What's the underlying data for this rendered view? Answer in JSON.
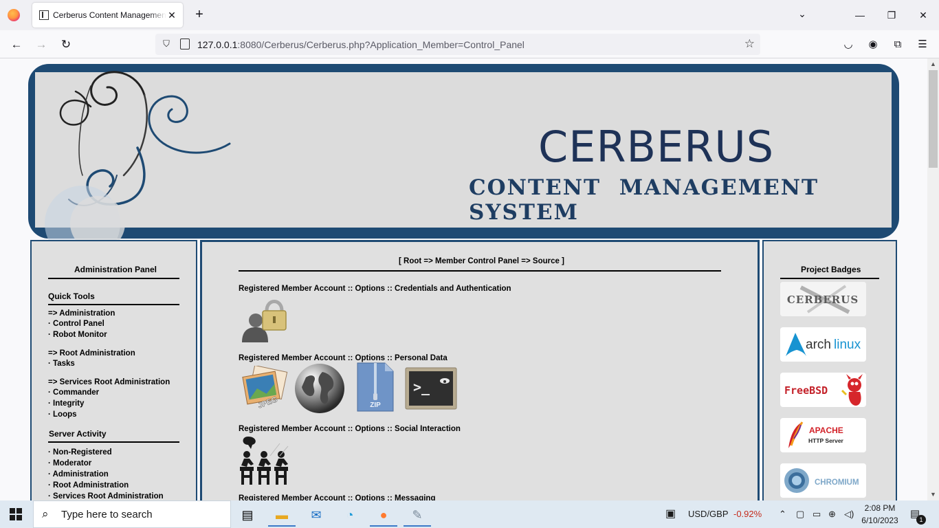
{
  "browser": {
    "tab_title": "Cerberus Content Management System",
    "new_tab": "+",
    "tab_close": "✕",
    "url_host": "127.0.0.1",
    "url_rest": ":8080/Cerberus/Cerberus.php?Application_Member=Control_Panel"
  },
  "banner": {
    "title": "CERBERUS",
    "subtitle": "CONTENT MANAGEMENT SYSTEM"
  },
  "left_panel": {
    "admin_title": "Administration Panel",
    "quick_tools_title": "Quick Tools",
    "items": [
      "=> Administration",
      "· Control Panel",
      "· Robot Monitor",
      "=> Root Administration",
      "· Tasks",
      "=> Services Root Administration",
      "· Commander",
      "· Integrity",
      "· Loops"
    ],
    "server_activity_title": "Server Activity",
    "activity_items": [
      "· Non-Registered",
      "· Moderator",
      "· Administration",
      "· Root Administration",
      "· Services Root Administration"
    ]
  },
  "center": {
    "breadcrumb": "[ Root => Member Control Panel => Source ]",
    "sections": [
      "Registered Member Account :: Options :: Credentials and Authentication",
      "Registered Member Account :: Options :: Personal Data",
      "Registered Member Account :: Options :: Social Interaction",
      "Registered Member Account :: Options :: Messaging"
    ],
    "jpeg_label": "JPEG",
    "zip_label": "ZIP",
    "terminal_label": ">_"
  },
  "right_panel": {
    "title": "Project Badges",
    "badges": {
      "cerberus": "CERBERUS",
      "arch_1": "arch",
      "arch_2": "linux",
      "freebsd": "FreeBSD",
      "apache_1": "APACHE",
      "apache_2": "HTTP Server",
      "chromium": "CHROMIUM"
    }
  },
  "taskbar": {
    "search_placeholder": "Type here to search",
    "currency": "USD/GBP",
    "currency_change": "-0.92%",
    "time": "2:08 PM",
    "date": "6/10/2023",
    "notification_count": "1"
  },
  "colors": {
    "frame_blue": "#1e4a73",
    "panel_bg": "#e0e0e0",
    "negative": "#c42b1c"
  }
}
